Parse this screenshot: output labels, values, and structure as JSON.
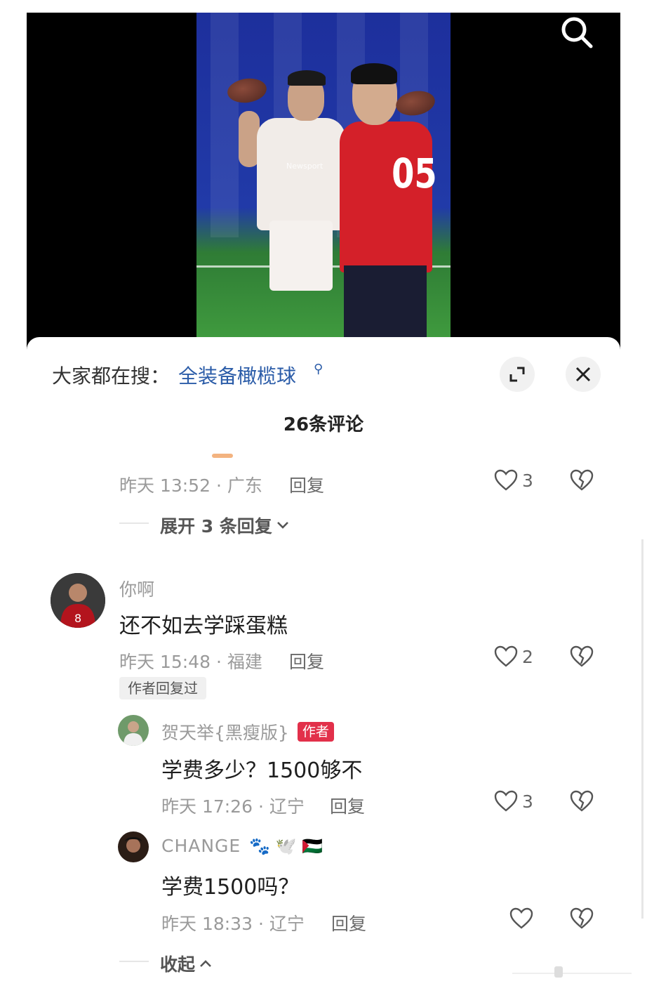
{
  "video": {
    "jersey_number": "05",
    "watermark": "Newsport",
    "search_icon": "search-icon"
  },
  "search_bar": {
    "prefix": "大家都在搜：",
    "term": "全装备橄榄球",
    "term_icon": "search-icon",
    "expand_icon": "expand-icon",
    "close_icon": "close-icon"
  },
  "comments_header": {
    "count_label": "26条评论"
  },
  "comments": [
    {
      "time_location": "昨天 13:52 · 广东",
      "reply_label": "回复",
      "likes": "3",
      "expand_label": "展开 3 条回复"
    },
    {
      "username": "你啊",
      "text": "还不如去学踩蛋糕",
      "time_location": "昨天 15:48 · 福建",
      "reply_label": "回复",
      "likes": "2",
      "author_replied_badge": "作者回复过",
      "replies": [
        {
          "username": "贺天举{黑瘦版}",
          "author_tag": "作者",
          "text": "学费多少？1500够不",
          "time_location": "昨天 17:26 · 辽宁",
          "reply_label": "回复",
          "likes": "3"
        },
        {
          "username": "CHANGE",
          "username_emojis": "🐾 🕊️ 🇵🇸",
          "text": "学费1500吗？",
          "time_location": "昨天 18:33 · 辽宁",
          "reply_label": "回复",
          "likes": ""
        }
      ],
      "collapse_label": "收起"
    }
  ],
  "colors": {
    "accent_link": "#2b5ca8",
    "author_tag": "#e2304a",
    "meta_text": "#9a9a9a"
  }
}
